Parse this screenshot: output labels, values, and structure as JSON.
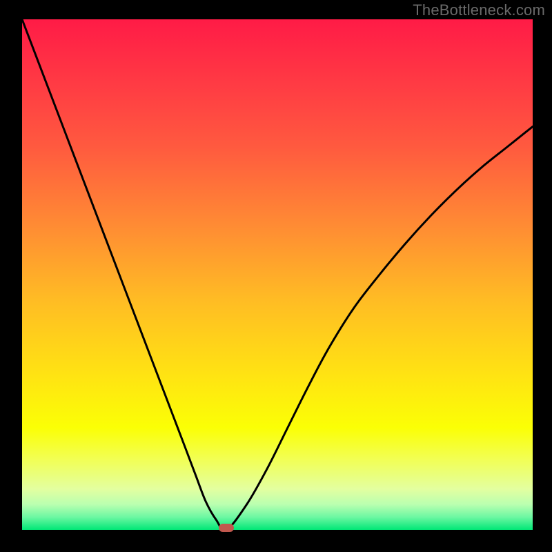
{
  "watermark": "TheBottleneck.com",
  "chart_data": {
    "type": "line",
    "title": "",
    "xlabel": "",
    "ylabel": "",
    "xlim": [
      0,
      100
    ],
    "ylim": [
      0,
      100
    ],
    "grid": false,
    "x": [
      0,
      4,
      8,
      12,
      16,
      20,
      24,
      28,
      32,
      34,
      36,
      38,
      40,
      44,
      48,
      52,
      56,
      60,
      65,
      70,
      75,
      80,
      85,
      90,
      95,
      100
    ],
    "values": [
      100,
      89.5,
      79,
      68.5,
      58,
      47.5,
      37,
      26.5,
      16,
      10.7,
      5.5,
      2,
      0,
      5,
      12,
      20,
      28,
      35.5,
      43.5,
      50,
      56,
      61.5,
      66.5,
      71,
      75,
      79
    ],
    "optimum_x": 40,
    "marker_color": "#c1584e",
    "gradient_stops": [
      {
        "offset": 0.0,
        "color": "#ff1b46"
      },
      {
        "offset": 0.12,
        "color": "#ff3944"
      },
      {
        "offset": 0.25,
        "color": "#ff5a3f"
      },
      {
        "offset": 0.4,
        "color": "#ff8a34"
      },
      {
        "offset": 0.55,
        "color": "#ffbc24"
      },
      {
        "offset": 0.7,
        "color": "#ffe412"
      },
      {
        "offset": 0.8,
        "color": "#fbff05"
      },
      {
        "offset": 0.86,
        "color": "#f2ff52"
      },
      {
        "offset": 0.92,
        "color": "#e3ffa0"
      },
      {
        "offset": 0.95,
        "color": "#baffb0"
      },
      {
        "offset": 0.975,
        "color": "#6cf7a2"
      },
      {
        "offset": 1.0,
        "color": "#00e776"
      }
    ]
  }
}
